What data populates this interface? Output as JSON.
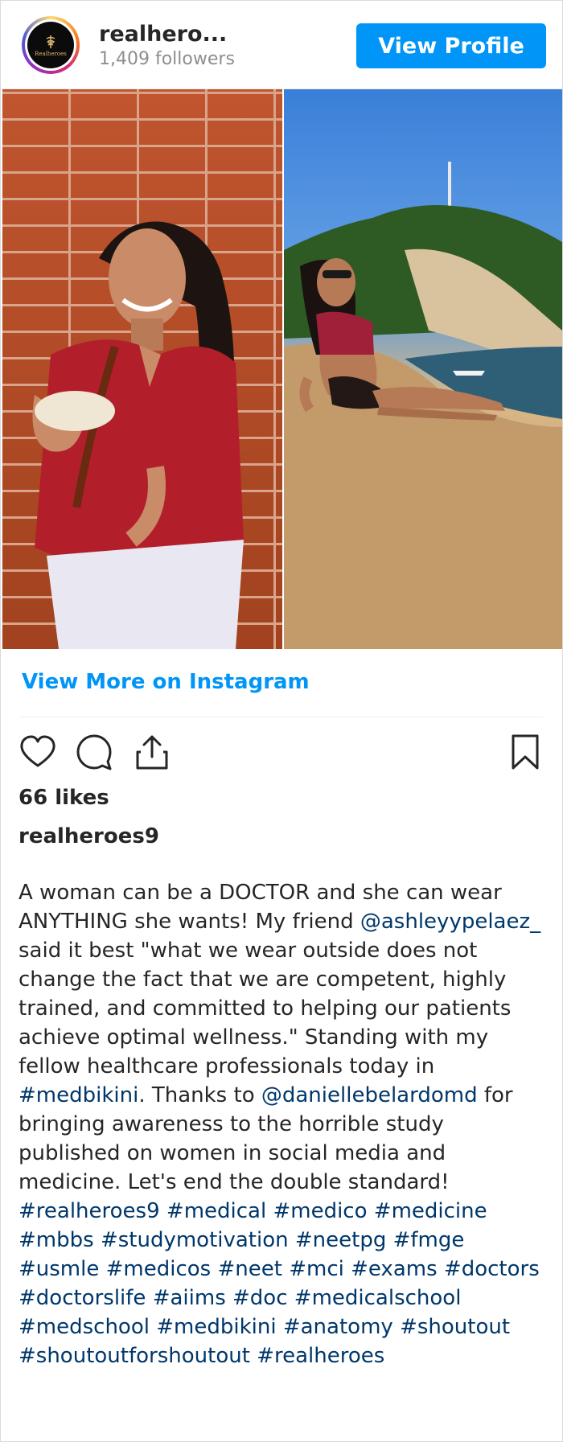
{
  "post": {
    "username": "realhero...",
    "followers": "1,409 followers",
    "view_profile_label": "View Profile",
    "avatar_logo_text": "Realheroes",
    "view_more_label": "View More on Instagram",
    "likes": "66 likes",
    "caption_user": "realheroes9",
    "caption_parts": [
      {
        "text": "A woman can be a DOCTOR and she can wear ANYTHING she wants! My friend ",
        "kind": "text"
      },
      {
        "text": "@ashleyypelaez_",
        "kind": "mention"
      },
      {
        "text": " said it best \"what we wear outside does not change the fact that we are competent, highly trained, and committed to helping our patients achieve optimal wellness.\" Standing with my fellow healthcare professionals today in ",
        "kind": "text"
      },
      {
        "text": "#medbikini",
        "kind": "tag"
      },
      {
        "text": ". Thanks to ",
        "kind": "text"
      },
      {
        "text": "@daniellebelardomd",
        "kind": "mention"
      },
      {
        "text": " for bringing awareness to the horrible study published on women in social media and medicine. Let's end the double standard!",
        "kind": "text"
      }
    ],
    "hashtags": [
      "#realheroes9",
      "#medical",
      "#medico",
      "#medicine",
      "#mbbs",
      "#studymotivation",
      "#neetpg",
      "#fmge",
      "#usmle",
      "#medicos",
      "#neet",
      "#mci",
      "#exams",
      "#doctors",
      "#doctorslife",
      "#aiims",
      "#doc",
      "#medicalschool",
      "#medschool",
      "#medbikini",
      "#anatomy",
      "#shoutout",
      "#shoutoutforshoutout",
      "#realheroes"
    ]
  },
  "icons": {
    "like": "heart-icon",
    "comment": "comment-icon",
    "share": "share-icon",
    "save": "bookmark-icon"
  },
  "colors": {
    "accent": "#0095f6",
    "hashtag": "#00376b",
    "text": "#262626",
    "muted": "#8e8e8e"
  }
}
